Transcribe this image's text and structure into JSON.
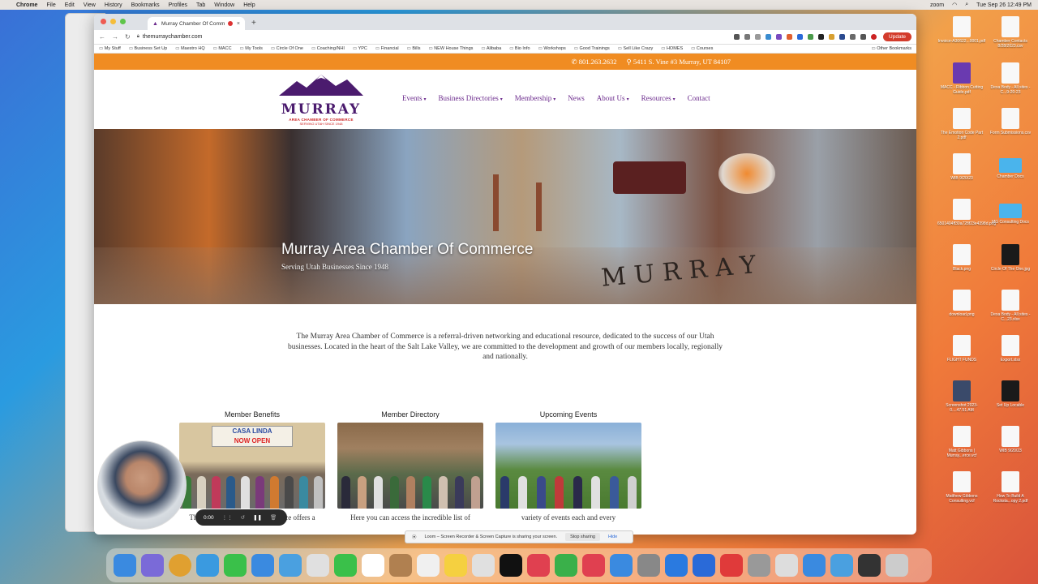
{
  "menubar": {
    "app": "Chrome",
    "items": [
      "File",
      "Edit",
      "View",
      "History",
      "Bookmarks",
      "Profiles",
      "Tab",
      "Window",
      "Help"
    ],
    "zoom": "zoom",
    "datetime": "Tue Sep 26  12:49 PM"
  },
  "browser": {
    "tab_title": "Murray Chamber Of Comm",
    "url": "themurraychamber.com",
    "update_label": "Update",
    "bookmarks": [
      "My Stuff",
      "Business Set Up",
      "Maestro HQ",
      "MACC",
      "My Tools",
      "Circle Of One",
      "Coaching/NHI",
      "YPC",
      "Financial",
      "Bills",
      "NEW House Things",
      "Alibaba",
      "Bio Info",
      "Workshops",
      "Good Trainings",
      "Sell Like Crazy",
      "HOMES",
      "Courses"
    ],
    "other_bookmarks": "Other Bookmarks"
  },
  "site": {
    "phone": "801.263.2632",
    "address": "5411 S. Vine #3 Murray, UT 84107",
    "logo": {
      "word": "MURRAY",
      "line1": "AREA CHAMBER OF COMMERCE",
      "line2": "SERVING UTAH SINCE 1948"
    },
    "nav": [
      {
        "label": "Events",
        "caret": true
      },
      {
        "label": "Business Directories",
        "caret": true
      },
      {
        "label": "Membership",
        "caret": true
      },
      {
        "label": "News",
        "caret": false
      },
      {
        "label": "About Us",
        "caret": true
      },
      {
        "label": "Resources",
        "caret": true
      },
      {
        "label": "Contact",
        "caret": false
      }
    ],
    "hero": {
      "title": "Murray Area Chamber Of Commerce",
      "tagline": "Serving Utah Businesses Since 1948",
      "sign_text": "MURRAY"
    },
    "intro": "The Murray Area Chamber of Commerce is a referral-driven networking and educational resource, dedicated to the success of our Utah businesses. Located in the heart of the Salt Lake Valley, we are committed to the development and growth of our members locally, regionally and nationally.",
    "cards": [
      {
        "title": "Member Benefits",
        "caption": "The Murray chamber of commerce offers a",
        "sign_a": "CASA LINDA",
        "sign_b": "NOW OPEN"
      },
      {
        "title": "Member Directory",
        "caption": "Here you can access the incredible list of"
      },
      {
        "title": "Upcoming Events",
        "caption": "variety of events each and every"
      }
    ]
  },
  "loom": {
    "share_text": "Loom – Screen Recorder & Screen Capture is sharing your screen.",
    "stop_label": "Stop sharing",
    "hide_label": "Hide",
    "timer": "0:00"
  },
  "desktop_icons": [
    "Invoice-A30622...0001.pdf",
    "Chamber Contacts 8/28/2023.csv",
    "MACC - Ribbon Cutting Guide.pdf",
    "Dexa Body - All sites - C...9-20-23",
    "The Emotion Code Part 2.pdf",
    "Form Submissions.csv",
    "WIB 9/20/23",
    "Chamber Docs",
    "6501404ff30a728f23e4398d.png",
    "MG Consulting Docs",
    "Black.png",
    "Circle Of The One.jpg",
    "download.png",
    "Dexa Body - All sites - C...23.xlsx",
    "FLIGHT FUNDS",
    "Export.xlsx",
    "Screenshot 2023-0....47.51 AM",
    "Set Up Locable",
    "Matt Gibbons | Murray...erce.vcf",
    "WIB 9/20/23",
    "Matthew Gibbons Consulting.vcf",
    "How To Build A Rocksta...opy 2.pdf"
  ],
  "colors": {
    "orange": "#f08c22",
    "purple": "#6b2a8c",
    "update_red": "#d33c2c"
  }
}
